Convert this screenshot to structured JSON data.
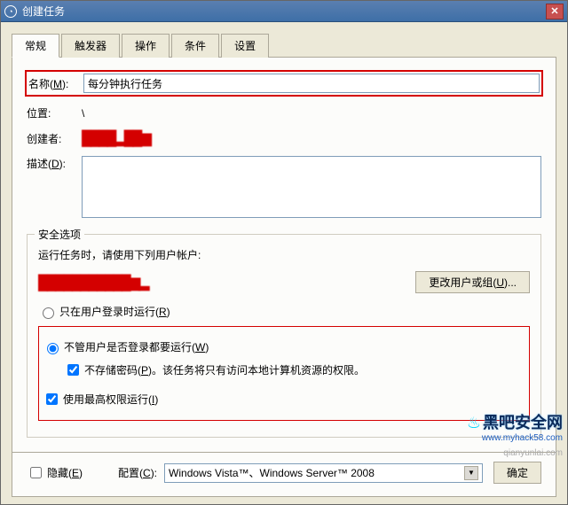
{
  "window": {
    "title": "创建任务"
  },
  "tabs": {
    "t0": "常规",
    "t1": "触发器",
    "t2": "操作",
    "t3": "条件",
    "t4": "设置"
  },
  "general": {
    "name_label": "名称(M):",
    "name_value": "每分钟执行任务",
    "location_label": "位置:",
    "location_value": "\\",
    "author_label": "创建者:",
    "author_value": "████████",
    "desc_label": "描述(D):",
    "desc_value": ""
  },
  "security": {
    "legend": "安全选项",
    "run_as_label": "运行任务时，请使用下列用户帐户:",
    "user_value": "████████████",
    "change_user_btn": "更改用户或组(U)...",
    "radio_logged_on": "只在用户登录时运行(R)",
    "radio_always": "不管用户是否登录都要运行(W)",
    "no_store_pwd": "不存储密码(P)。该任务将只有访问本地计算机资源的权限。",
    "highest_priv": "使用最高权限运行(I)"
  },
  "bottom": {
    "hidden_label": "隐藏(E)",
    "config_label": "配置(C):",
    "config_value": "Windows Vista™、Windows Server™ 2008",
    "ok": "确定"
  },
  "watermark": {
    "brand": "黑吧安全网",
    "url1": "www.myhack58.com",
    "url2": "qianyunlai.com"
  }
}
